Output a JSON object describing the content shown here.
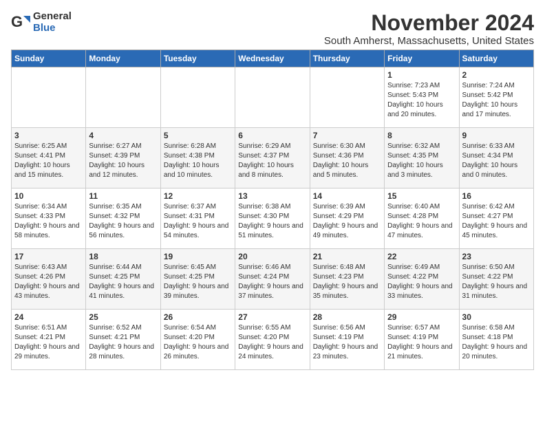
{
  "logo": {
    "general": "General",
    "blue": "Blue"
  },
  "title": "November 2024",
  "location": "South Amherst, Massachusetts, United States",
  "weekdays": [
    "Sunday",
    "Monday",
    "Tuesday",
    "Wednesday",
    "Thursday",
    "Friday",
    "Saturday"
  ],
  "weeks": [
    [
      {
        "day": "",
        "info": ""
      },
      {
        "day": "",
        "info": ""
      },
      {
        "day": "",
        "info": ""
      },
      {
        "day": "",
        "info": ""
      },
      {
        "day": "",
        "info": ""
      },
      {
        "day": "1",
        "info": "Sunrise: 7:23 AM\nSunset: 5:43 PM\nDaylight: 10 hours and 20 minutes."
      },
      {
        "day": "2",
        "info": "Sunrise: 7:24 AM\nSunset: 5:42 PM\nDaylight: 10 hours and 17 minutes."
      }
    ],
    [
      {
        "day": "3",
        "info": "Sunrise: 6:25 AM\nSunset: 4:41 PM\nDaylight: 10 hours and 15 minutes."
      },
      {
        "day": "4",
        "info": "Sunrise: 6:27 AM\nSunset: 4:39 PM\nDaylight: 10 hours and 12 minutes."
      },
      {
        "day": "5",
        "info": "Sunrise: 6:28 AM\nSunset: 4:38 PM\nDaylight: 10 hours and 10 minutes."
      },
      {
        "day": "6",
        "info": "Sunrise: 6:29 AM\nSunset: 4:37 PM\nDaylight: 10 hours and 8 minutes."
      },
      {
        "day": "7",
        "info": "Sunrise: 6:30 AM\nSunset: 4:36 PM\nDaylight: 10 hours and 5 minutes."
      },
      {
        "day": "8",
        "info": "Sunrise: 6:32 AM\nSunset: 4:35 PM\nDaylight: 10 hours and 3 minutes."
      },
      {
        "day": "9",
        "info": "Sunrise: 6:33 AM\nSunset: 4:34 PM\nDaylight: 10 hours and 0 minutes."
      }
    ],
    [
      {
        "day": "10",
        "info": "Sunrise: 6:34 AM\nSunset: 4:33 PM\nDaylight: 9 hours and 58 minutes."
      },
      {
        "day": "11",
        "info": "Sunrise: 6:35 AM\nSunset: 4:32 PM\nDaylight: 9 hours and 56 minutes."
      },
      {
        "day": "12",
        "info": "Sunrise: 6:37 AM\nSunset: 4:31 PM\nDaylight: 9 hours and 54 minutes."
      },
      {
        "day": "13",
        "info": "Sunrise: 6:38 AM\nSunset: 4:30 PM\nDaylight: 9 hours and 51 minutes."
      },
      {
        "day": "14",
        "info": "Sunrise: 6:39 AM\nSunset: 4:29 PM\nDaylight: 9 hours and 49 minutes."
      },
      {
        "day": "15",
        "info": "Sunrise: 6:40 AM\nSunset: 4:28 PM\nDaylight: 9 hours and 47 minutes."
      },
      {
        "day": "16",
        "info": "Sunrise: 6:42 AM\nSunset: 4:27 PM\nDaylight: 9 hours and 45 minutes."
      }
    ],
    [
      {
        "day": "17",
        "info": "Sunrise: 6:43 AM\nSunset: 4:26 PM\nDaylight: 9 hours and 43 minutes."
      },
      {
        "day": "18",
        "info": "Sunrise: 6:44 AM\nSunset: 4:25 PM\nDaylight: 9 hours and 41 minutes."
      },
      {
        "day": "19",
        "info": "Sunrise: 6:45 AM\nSunset: 4:25 PM\nDaylight: 9 hours and 39 minutes."
      },
      {
        "day": "20",
        "info": "Sunrise: 6:46 AM\nSunset: 4:24 PM\nDaylight: 9 hours and 37 minutes."
      },
      {
        "day": "21",
        "info": "Sunrise: 6:48 AM\nSunset: 4:23 PM\nDaylight: 9 hours and 35 minutes."
      },
      {
        "day": "22",
        "info": "Sunrise: 6:49 AM\nSunset: 4:22 PM\nDaylight: 9 hours and 33 minutes."
      },
      {
        "day": "23",
        "info": "Sunrise: 6:50 AM\nSunset: 4:22 PM\nDaylight: 9 hours and 31 minutes."
      }
    ],
    [
      {
        "day": "24",
        "info": "Sunrise: 6:51 AM\nSunset: 4:21 PM\nDaylight: 9 hours and 29 minutes."
      },
      {
        "day": "25",
        "info": "Sunrise: 6:52 AM\nSunset: 4:21 PM\nDaylight: 9 hours and 28 minutes."
      },
      {
        "day": "26",
        "info": "Sunrise: 6:54 AM\nSunset: 4:20 PM\nDaylight: 9 hours and 26 minutes."
      },
      {
        "day": "27",
        "info": "Sunrise: 6:55 AM\nSunset: 4:20 PM\nDaylight: 9 hours and 24 minutes."
      },
      {
        "day": "28",
        "info": "Sunrise: 6:56 AM\nSunset: 4:19 PM\nDaylight: 9 hours and 23 minutes."
      },
      {
        "day": "29",
        "info": "Sunrise: 6:57 AM\nSunset: 4:19 PM\nDaylight: 9 hours and 21 minutes."
      },
      {
        "day": "30",
        "info": "Sunrise: 6:58 AM\nSunset: 4:18 PM\nDaylight: 9 hours and 20 minutes."
      }
    ]
  ]
}
